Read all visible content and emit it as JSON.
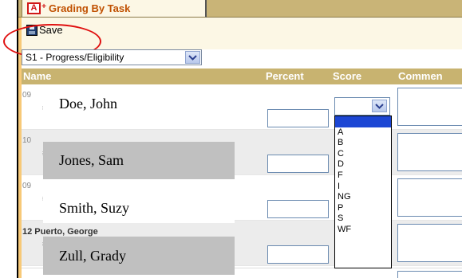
{
  "tab": {
    "icon_letter": "A",
    "icon_plus": "+",
    "label": "Grading By Task"
  },
  "toolbar": {
    "save_label": "Save"
  },
  "task_select": {
    "value": "S1 - Progress/Eligibility"
  },
  "table": {
    "headers": {
      "name": "Name",
      "percent": "Percent",
      "score": "Score",
      "comment": "Commen"
    },
    "rows": [
      {
        "num": "09",
        "mark": "#"
      },
      {
        "num": "10",
        "mark": "#"
      },
      {
        "num": "09",
        "mark": "#"
      },
      {
        "num": "12 Puerto, George",
        "mark": "#"
      }
    ]
  },
  "names": [
    "Doe, John",
    "Jones, Sam",
    "Smith, Suzy",
    "Zull, Grady"
  ],
  "score_dropdown": {
    "selected": "",
    "options": [
      "",
      "A",
      "B",
      "C",
      "D",
      "F",
      "I",
      "NG",
      "P",
      "S",
      "WF"
    ]
  },
  "colors": {
    "tab_strip": "#c9b477",
    "header_bar": "#c8b370",
    "tab_label": "#c05000",
    "annotation_circle": "#e01010",
    "selected_option": "#1c46d4"
  }
}
